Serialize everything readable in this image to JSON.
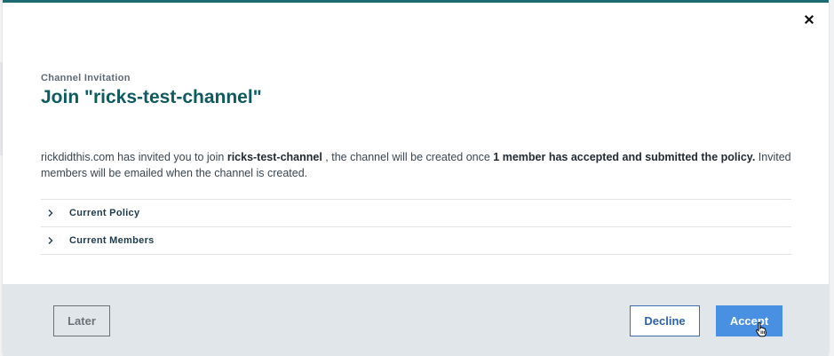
{
  "modal": {
    "eyebrow": "Channel Invitation",
    "title": "Join \"ricks-test-channel\"",
    "description": {
      "part1": "rickdidthis.com has invited you to join ",
      "channel": "ricks-test-channel",
      "part2": " , the channel will be created once ",
      "condition": "1 member has accepted and submitted the policy.",
      "part3": " Invited members will be emailed when the channel is created."
    },
    "sections": [
      {
        "label": "Current Policy",
        "icon": "chevron-right-icon"
      },
      {
        "label": "Current Members",
        "icon": "chevron-right-icon"
      }
    ],
    "close_icon": "close-icon"
  },
  "footer": {
    "later_label": "Later",
    "decline_label": "Decline",
    "accept_label": "Accept"
  },
  "colors": {
    "accent_top": "#1c6b73",
    "title": "#0f5a60",
    "primary_button": "#4a90e2",
    "footer_bg": "#e1e6eb"
  }
}
